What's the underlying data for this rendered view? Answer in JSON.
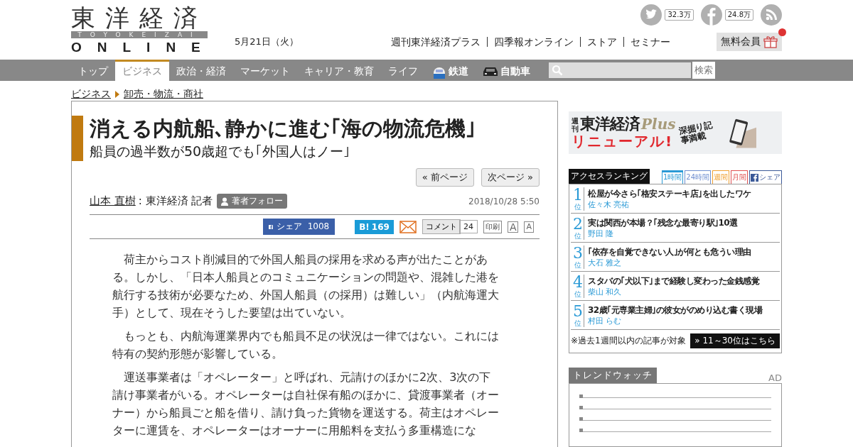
{
  "header": {
    "logo": {
      "kanji": "東洋経済",
      "roman": "TOYOKEIZAI",
      "online": "ONLINE"
    },
    "date": "5月21日（火）",
    "social": [
      {
        "kind": "twitter",
        "count": "32.3万"
      },
      {
        "kind": "facebook",
        "count": "24.8万"
      },
      {
        "kind": "rss"
      }
    ],
    "links": [
      "週刊東洋経済プラス",
      "四季報オンライン",
      "ストア",
      "セミナー"
    ],
    "member_button": {
      "label": "無料会員",
      "notification": true
    }
  },
  "nav": {
    "items": [
      {
        "label": "トップ",
        "kind": "text",
        "selected": false
      },
      {
        "label": "ビジネス",
        "kind": "text",
        "selected": true
      },
      {
        "label": "政治・経済",
        "kind": "text",
        "selected": false
      },
      {
        "label": "マーケット",
        "kind": "text",
        "selected": false
      },
      {
        "label": "キャリア・教育",
        "kind": "text",
        "selected": false
      },
      {
        "label": "ライフ",
        "kind": "text",
        "selected": false
      },
      {
        "label": "鉄道",
        "kind": "train",
        "selected": false
      },
      {
        "label": "自動車",
        "kind": "car",
        "selected": false
      }
    ],
    "search_button": "検索"
  },
  "breadcrumb": [
    "ビジネス",
    "卸売・物流・商社"
  ],
  "article": {
    "title": "消える内航船､静かに進む｢海の物流危機｣",
    "subtitle": "船員の過半数が50歳超でも｢外国人はノー｣",
    "pager": [
      "« 前ページ",
      "次ページ »"
    ],
    "author": "山本 直樹",
    "affiliation": " : 東洋経済 記者",
    "follow_button": "著者フォロー",
    "date": "2018/10/28 5:50",
    "share": {
      "facebook": "シェア  1008",
      "hatena_mark": "B!",
      "hatena_count": "169",
      "comment_button": "コメント",
      "comment_count": "24",
      "print_button": "印刷",
      "font_large": "A",
      "font_small": "A"
    },
    "paragraphs": [
      "荷主からコスト削減目的で外国人船員の採用を求める声が出たことがある。しかし、「日本人船員とのコミュニケーションの問題や、混雑した港を航行する技術が必要なため、外国人船員（の採用）は難しい」（内航海運大手）として、現在そうした要望は出ていない。",
      "もっとも、内航海運業界内でも船員不足の状況は一律ではない。これには特有の契約形態が影響している。",
      "運送事業者は「オペレーター」と呼ばれ、元請けのほかに2次、3次の下請け事業者がいる。オペレーターは自社保有船のほかに、貸渡事業者（オーナー）から船員ごと船を借り、請け負った貨物を運送する。荷主はオペレーターに運賃を、オペレーターはオーナーに用船料を支払う多重構造にな"
    ]
  },
  "sidebar": {
    "banner": {
      "kicker": "週刊",
      "brand": "東洋経済",
      "plus": "Plus",
      "headline": "リニューアル!",
      "tagline": "深掘り記事満載"
    },
    "ranking": {
      "title": "アクセスランキング",
      "tabs": [
        {
          "label": "1時間",
          "color": "#2a9ad6",
          "selected": true
        },
        {
          "label": "24時間",
          "color": "#6f8fd0",
          "selected": false
        },
        {
          "label": "週間",
          "color": "#f0a030",
          "selected": false
        },
        {
          "label": "月間",
          "color": "#e05050",
          "selected": false
        },
        {
          "label": "シェア",
          "color": "#3b5998",
          "selected": false,
          "kind": "facebook"
        }
      ],
      "items": [
        {
          "rank": "1",
          "suffix": "位",
          "title": "松屋が今さら｢格安ステーキ店｣を出したワケ",
          "author": "佐々木 亮祐"
        },
        {
          "rank": "2",
          "suffix": "位",
          "title": "実は関西が本場？｢残念な最寄り駅｣10選",
          "author": "野田 隆"
        },
        {
          "rank": "3",
          "suffix": "位",
          "title": "｢依存を自覚できない人｣が何とも危うい理由",
          "author": "大石 雅之"
        },
        {
          "rank": "4",
          "suffix": "位",
          "title": "スタバの｢犬以下｣まで経験し変わった金銭感覚",
          "author": "柴山 和久"
        },
        {
          "rank": "5",
          "suffix": "位",
          "title": "32歳｢元専業主婦｣の彼女がのめり込む書く現場",
          "author": "村田 らむ"
        }
      ],
      "note": "※過去1週間以内の記事が対象",
      "more_button": "» 11～30位はこちら"
    },
    "trend": {
      "title": "トレンドウォッチ",
      "ad_label": "AD"
    }
  }
}
